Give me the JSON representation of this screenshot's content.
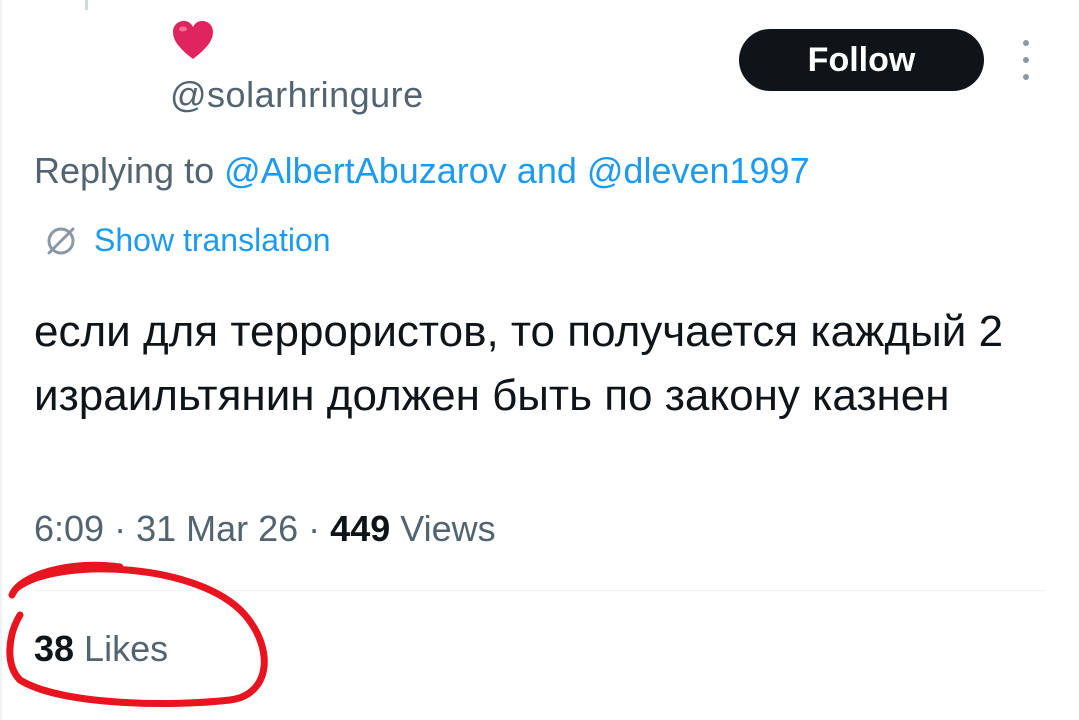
{
  "colors": {
    "accent": "#1d9bf0",
    "secondary_text": "#536471",
    "primary_text": "#0f1419",
    "button_bg": "#0f1419",
    "heart": "#e0245e",
    "annotation": "#e8141f"
  },
  "author": {
    "display_icon": "heart-emoji-icon",
    "handle": "@solarhringure"
  },
  "follow_button": {
    "label": "Follow"
  },
  "more_menu": {
    "icon": "vertical-dots-icon"
  },
  "reply_context": {
    "prefix": "Replying to ",
    "user1": "@AlbertAbuzarov",
    "conjunction": " and ",
    "user2": "@dleven1997"
  },
  "translation": {
    "icon": "globe-translate-icon",
    "label": "Show translation"
  },
  "tweet": {
    "text": "если для террористов, то получается каждый 2 израильтянин должен быть по закону казнен"
  },
  "meta": {
    "time": "6:09",
    "separator1": " · ",
    "date": "31 Mar 26",
    "separator2": " · ",
    "views_count": "449",
    "views_label": " Views"
  },
  "likes": {
    "count": "38",
    "label": " Likes"
  }
}
